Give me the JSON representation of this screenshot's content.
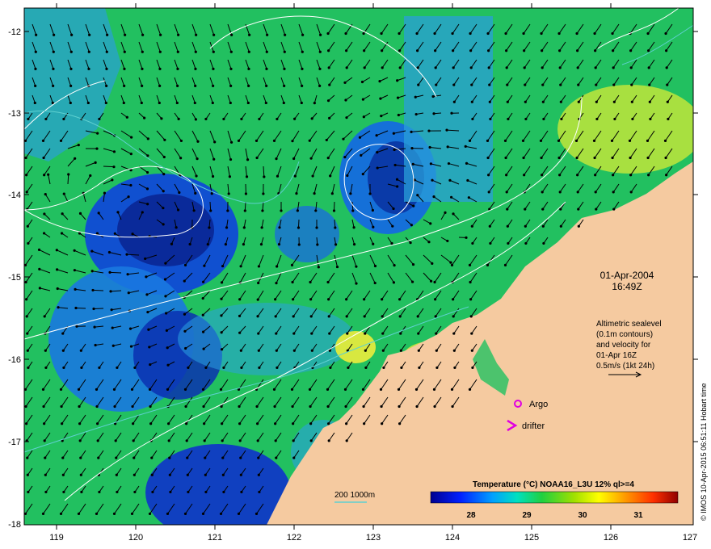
{
  "map": {
    "date": "01-Apr-2004",
    "time": "16:49Z",
    "info_lines": [
      "Altimetric sealevel",
      "(0.1m contours)",
      "and velocity for",
      "01-Apr 16Z",
      "0.5m/s (1kt 24h)"
    ],
    "argo_label": "Argo",
    "drifter_label": "drifter",
    "depth_legend": "200  1000m",
    "colorbar_title": "Temperature (°C) NOAA16_L3U 12% ql>=4",
    "colorbar_ticks": [
      "28",
      "29",
      "30",
      "31"
    ],
    "credit": "© IMOS 10-Apr-2015 06:51:11 Hobart time",
    "x_ticks": [
      "119",
      "120",
      "121",
      "122",
      "123",
      "124",
      "125",
      "126",
      "127"
    ],
    "y_ticks": [
      "-12",
      "-13",
      "-14",
      "-15",
      "-16",
      "-17",
      "-18"
    ]
  },
  "colors": {
    "land": "#f5caa0",
    "ocean_green": "#22c060",
    "argo_marker": "#e000e0",
    "drifter_marker": "#e000e0",
    "depth_200": "#5fd0d0"
  }
}
